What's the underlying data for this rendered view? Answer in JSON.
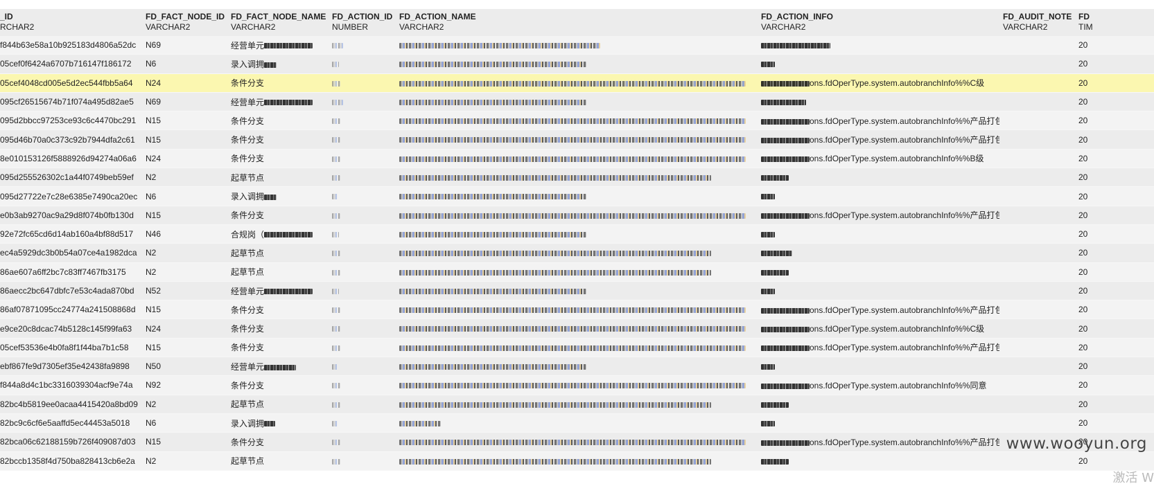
{
  "columns": [
    {
      "name": "_ID",
      "type": "RCHAR2"
    },
    {
      "name": "FD_FACT_NODE_ID",
      "type": "VARCHAR2"
    },
    {
      "name": "FD_FACT_NODE_NAME",
      "type": "VARCHAR2"
    },
    {
      "name": "FD_ACTION_ID",
      "type": "NUMBER"
    },
    {
      "name": "FD_ACTION_NAME",
      "type": "VARCHAR2"
    },
    {
      "name": "FD_ACTION_INFO",
      "type": "VARCHAR2"
    },
    {
      "name": "FD_AUDIT_NOTE",
      "type": "VARCHAR2"
    },
    {
      "name": "FD",
      "type": "TIM"
    }
  ],
  "rows": [
    {
      "id": "f844b63e58a10b925183d4806a52dc",
      "node_id": "N69",
      "node_name": "经营单元",
      "info_text": "",
      "last": "20"
    },
    {
      "id": "05cef0f6424a6707b716147f186172",
      "node_id": "N6",
      "node_name": "录入调拥",
      "info_text": "",
      "last": "20"
    },
    {
      "id": "05cef4048cd005e5d2ec544fbb5a64",
      "node_id": "N24",
      "node_name": "条件分支",
      "info_text": "ons.fdOperType.system.autobranchInfo%%C级",
      "last": "20",
      "highlight": true
    },
    {
      "id": "095cf26515674b71f074a495d82ae5",
      "node_id": "N69",
      "node_name": "经营单元",
      "info_text": "",
      "last": "20"
    },
    {
      "id": "095d2bbcc97253ce93c6c4470bc291",
      "node_id": "N15",
      "node_name": "条件分支",
      "info_text": "ons.fdOperType.system.autobranchInfo%%产品打包",
      "last": "20"
    },
    {
      "id": "095d46b70a0c373c92b7944dfa2c61",
      "node_id": "N15",
      "node_name": "条件分支",
      "info_text": "ons.fdOperType.system.autobranchInfo%%产品打包",
      "last": "20"
    },
    {
      "id": "8e010153126f5888926d94274a06a6",
      "node_id": "N24",
      "node_name": "条件分支",
      "info_text": "ons.fdOperType.system.autobranchInfo%%B级",
      "last": "20"
    },
    {
      "id": "095d255526302c1a44f0749beb59ef",
      "node_id": "N2",
      "node_name": "起草节点",
      "info_text": "",
      "last": "20"
    },
    {
      "id": "095d27722e7c28e6385e7490ca20ec",
      "node_id": "N6",
      "node_name": "录入调拥",
      "info_text": "",
      "last": "20"
    },
    {
      "id": "e0b3ab9270ac9a29d8f074b0fb130d",
      "node_id": "N15",
      "node_name": "条件分支",
      "info_text": "ons.fdOperType.system.autobranchInfo%%产品打包",
      "last": "20"
    },
    {
      "id": "92e72fc65cd6d14ab160a4bf88d517",
      "node_id": "N46",
      "node_name": "合规岗（",
      "info_text": "",
      "last": "20"
    },
    {
      "id": "ec4a5929dc3b0b54a07ce4a1982dca",
      "node_id": "N2",
      "node_name": "起草节点",
      "info_text": "",
      "last": "20"
    },
    {
      "id": "86ae607a6ff2bc7c83ff7467fb3175",
      "node_id": "N2",
      "node_name": "起草节点",
      "info_text": "",
      "last": "20"
    },
    {
      "id": "86aecc2bc647dbfc7e53c4ada870bd",
      "node_id": "N52",
      "node_name": "经营单元",
      "info_text": "",
      "last": "20"
    },
    {
      "id": "86af07871095cc24774a241508868d",
      "node_id": "N15",
      "node_name": "条件分支",
      "info_text": "ons.fdOperType.system.autobranchInfo%%产品打包",
      "last": "20"
    },
    {
      "id": "e9ce20c8dcac74b5128c145f99fa63",
      "node_id": "N24",
      "node_name": "条件分支",
      "info_text": "ons.fdOperType.system.autobranchInfo%%C级",
      "last": "20"
    },
    {
      "id": "05cef53536e4b0fa8f1f44ba7b1c58",
      "node_id": "N15",
      "node_name": "条件分支",
      "info_text": "ons.fdOperType.system.autobranchInfo%%产品打包",
      "last": "20"
    },
    {
      "id": "ebf867fe9d7305ef35e42438fa9898",
      "node_id": "N50",
      "node_name": "经营单元",
      "info_text": "",
      "last": "20"
    },
    {
      "id": "f844a8d4c1bc3316039304acf9e74a",
      "node_id": "N92",
      "node_name": "条件分支",
      "info_text": "ons.fdOperType.system.autobranchInfo%%同意",
      "last": "20"
    },
    {
      "id": "82bc4b5819ee0acaa4415420a8bd09",
      "node_id": "N2",
      "node_name": "起草节点",
      "info_text": "",
      "last": "20"
    },
    {
      "id": "82bc9c6cf6e5aaffd5ec44453a5018",
      "node_id": "N6",
      "node_name": "录入调拥",
      "info_text": "",
      "last": "20"
    },
    {
      "id": "82bca06c62188159b726f409087d03",
      "node_id": "N15",
      "node_name": "条件分支",
      "info_text": "ons.fdOperType.system.autobranchInfo%%产品打包",
      "last": "20"
    },
    {
      "id": "82bccb1358f4d750ba828413cb6e2a",
      "node_id": "N2",
      "node_name": "起草节点",
      "info_text": "",
      "last": "20"
    }
  ],
  "watermark": "www.wooyun.org",
  "watermark2": "激活 W"
}
